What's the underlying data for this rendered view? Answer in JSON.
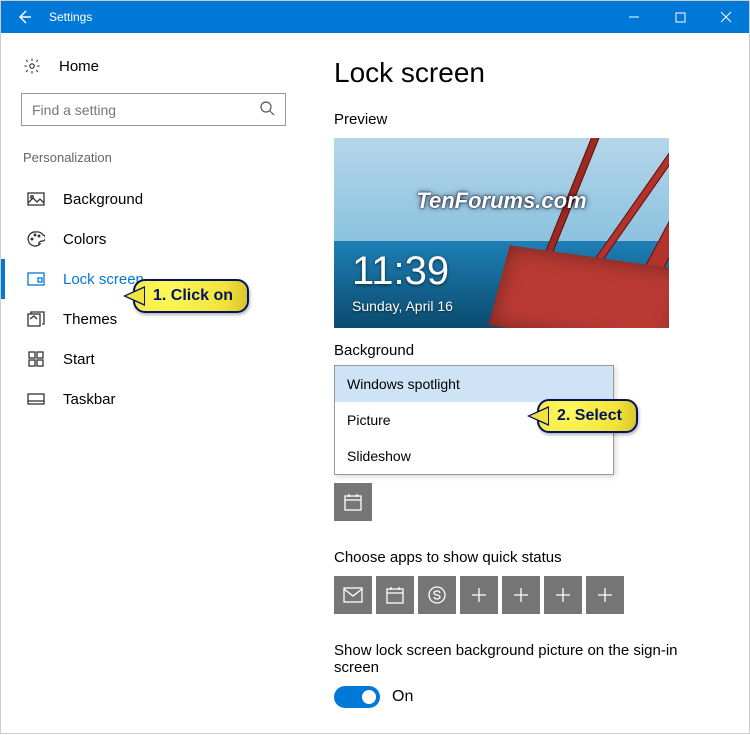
{
  "titlebar": {
    "title": "Settings"
  },
  "sidebar": {
    "home": "Home",
    "search_placeholder": "Find a setting",
    "section": "Personalization",
    "items": [
      {
        "label": "Background"
      },
      {
        "label": "Colors"
      },
      {
        "label": "Lock screen"
      },
      {
        "label": "Themes"
      },
      {
        "label": "Start"
      },
      {
        "label": "Taskbar"
      }
    ]
  },
  "main": {
    "title": "Lock screen",
    "preview_label": "Preview",
    "preview": {
      "watermark": "TenForums.com",
      "clock": "11:39",
      "date": "Sunday, April 16"
    },
    "background_label": "Background",
    "dropdown": {
      "options": [
        {
          "label": "Windows spotlight",
          "selected": true
        },
        {
          "label": "Picture"
        },
        {
          "label": "Slideshow"
        }
      ]
    },
    "quick_status_label": "Choose apps to show quick status",
    "signin_label": "Show lock screen background picture on the sign-in screen",
    "toggle_state_label": "On"
  },
  "annotations": {
    "a1": "1. Click on",
    "a2": "2. Select"
  }
}
